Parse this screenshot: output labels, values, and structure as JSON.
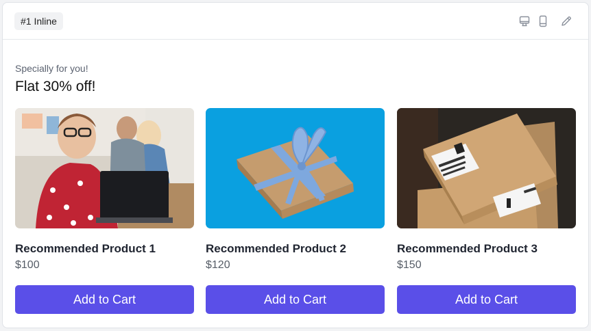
{
  "header": {
    "badge": "#1 Inline",
    "icons": [
      "desktop-icon",
      "mobile-icon",
      "edit-icon"
    ]
  },
  "banner": {
    "subtitle": "Specially for you!",
    "headline": "Flat 30% off!"
  },
  "products": [
    {
      "name": "Recommended Product 1",
      "price": "$100",
      "cta": "Add to Cart",
      "image": "woman-laptop-photo"
    },
    {
      "name": "Recommended Product 2",
      "price": "$120",
      "cta": "Add to Cart",
      "image": "gift-box-photo"
    },
    {
      "name": "Recommended Product 3",
      "price": "$150",
      "cta": "Add to Cart",
      "image": "shipping-boxes-photo"
    }
  ],
  "colors": {
    "accent": "#5a4fe8",
    "text": "#1f2430",
    "muted": "#5b6270"
  }
}
